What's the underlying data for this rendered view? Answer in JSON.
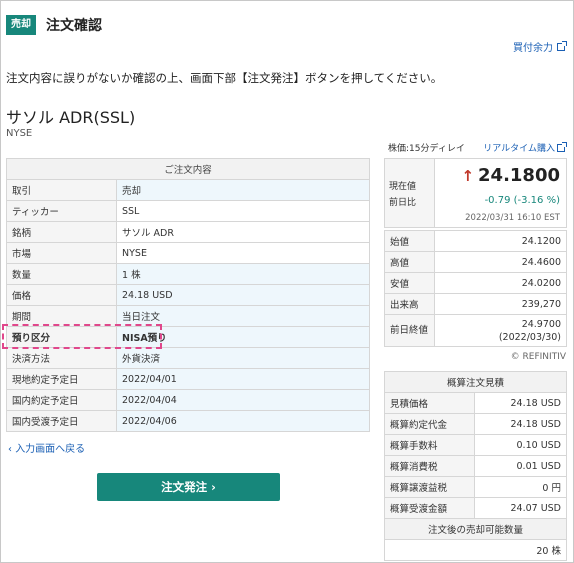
{
  "header": {
    "badge": "売却",
    "title": "注文確認"
  },
  "buying_power_link": "買付余力",
  "notice": "注文内容に誤りがないか確認の上、画面下部【注文発注】ボタンを押してください。",
  "stock": {
    "name": "サソル ADR(SSL)",
    "market": "NYSE"
  },
  "order_table": {
    "title": "ご注文内容",
    "rows": [
      {
        "label": "取引",
        "value": "売却"
      },
      {
        "label": "ティッカー",
        "value": "SSL"
      },
      {
        "label": "銘柄",
        "value": "サソル ADR"
      },
      {
        "label": "市場",
        "value": "NYSE"
      },
      {
        "label": "数量",
        "value": "1 株"
      },
      {
        "label": "価格",
        "value": "24.18 USD"
      },
      {
        "label": "期間",
        "value": "当日注文"
      },
      {
        "label": "預り区分",
        "value": "NISA預り"
      },
      {
        "label": "決済方法",
        "value": "外貨決済"
      },
      {
        "label": "現地約定予定日",
        "value": "2022/04/01"
      },
      {
        "label": "国内約定予定日",
        "value": "2022/04/04"
      },
      {
        "label": "国内受渡予定日",
        "value": "2022/04/06"
      }
    ]
  },
  "back_link": "入力画面へ戻る",
  "submit_button": "注文発注 ›",
  "price_delay": "株価:15分ディレイ",
  "realtime_link": "リアルタイム購入",
  "quote": {
    "label_current": "現在値",
    "label_change": "前日比",
    "price": "24.1800",
    "change": "-0.79 (-3.16 %)",
    "timestamp": "2022/03/31 16:10 EST",
    "rows": [
      {
        "label": "始値",
        "value": "24.1200"
      },
      {
        "label": "高値",
        "value": "24.4600"
      },
      {
        "label": "安値",
        "value": "24.0200"
      },
      {
        "label": "出来高",
        "value": "239,270"
      }
    ],
    "prev_close_label": "前日終値",
    "prev_close_value": "24.9700",
    "prev_close_date": "(2022/03/30)"
  },
  "source": "© REFINITIV",
  "estimate": {
    "title": "概算注文見積",
    "rows": [
      {
        "label": "見積価格",
        "value": "24.18 USD"
      },
      {
        "label": "概算約定代金",
        "value": "24.18 USD"
      },
      {
        "label": "概算手数料",
        "value": "0.10 USD"
      },
      {
        "label": "概算消費税",
        "value": "0.01 USD"
      },
      {
        "label": "概算譲渡益税",
        "value": "0 円"
      },
      {
        "label": "概算受渡金額",
        "value": "24.07 USD"
      }
    ],
    "sellable_title": "注文後の売却可能数量",
    "sellable_value": "20 株"
  },
  "colors": {
    "accent": "#17877b",
    "link": "#1a5fb4",
    "highlight": "#e0478b",
    "down": "#c0392b"
  }
}
